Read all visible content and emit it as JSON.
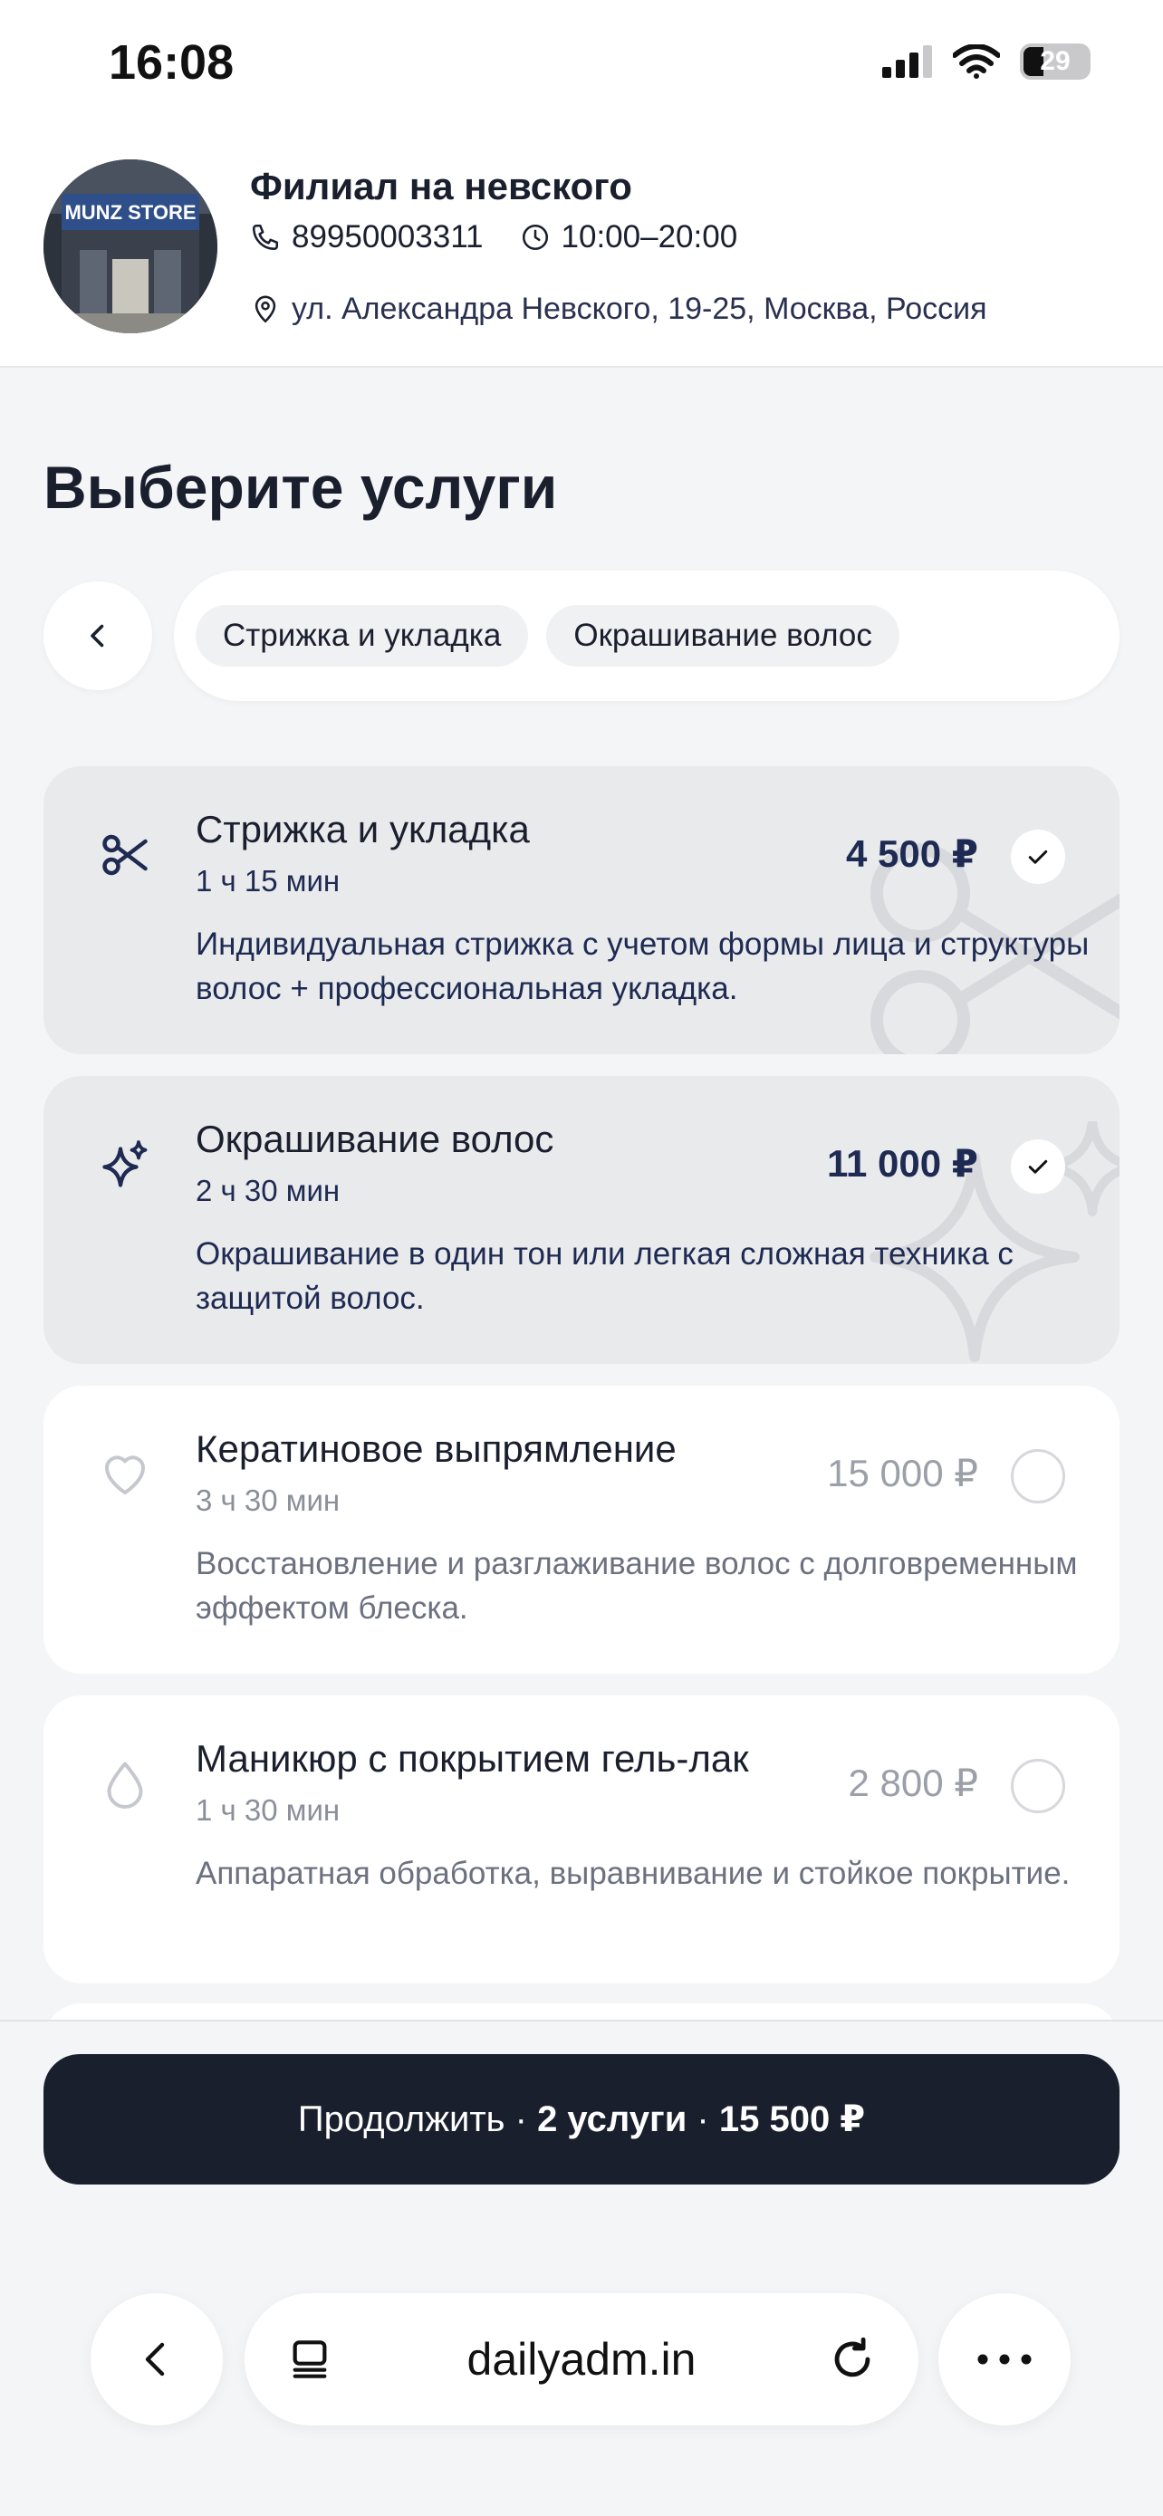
{
  "status_bar": {
    "time": "16:08",
    "battery": "29"
  },
  "branch": {
    "name": "Филиал на невского",
    "phone": "89950003311",
    "hours": "10:00–20:00",
    "address": "ул. Александра Невского, 19-25, Москва, Россия",
    "store_sign": "MUNZ STORE"
  },
  "page_title": "Выберите услуги",
  "category_chips": [
    "Стрижка и укладка",
    "Окрашивание волос"
  ],
  "services": [
    {
      "title": "Стрижка и укладка",
      "duration": "1 ч 15 мин",
      "price": "4 500 ₽",
      "description": "Индивидуальная стрижка с учетом формы лица и структуры волос + профессиональная укладка.",
      "selected": true,
      "icon": "scissors-icon"
    },
    {
      "title": "Окрашивание волос",
      "duration": "2 ч 30 мин",
      "price": "11 000 ₽",
      "description": "Окрашивание в один тон или легкая сложная техника с защитой волос.",
      "selected": true,
      "icon": "sparkles-icon"
    },
    {
      "title": "Кератиновое выпрямление",
      "duration": "3 ч 30 мин",
      "price": "15 000 ₽",
      "description": "Восстановление и разглаживание волос с долговременным эффектом блеска.",
      "selected": false,
      "icon": "heart-icon"
    },
    {
      "title": "Маникюр с покрытием гель-лак",
      "duration": "1 ч 30 мин",
      "price": "2 800 ₽",
      "description": "Аппаратная обработка, выравнивание и стойкое покрытие.",
      "selected": false,
      "icon": "drop-icon"
    }
  ],
  "cta": {
    "prefix": "Продолжить · ",
    "count": "2 услуги",
    "sep": " · ",
    "total": "15 500 ₽"
  },
  "browser": {
    "url": "dailyadm.in"
  },
  "colors": {
    "accent": "#1a1f2e",
    "selected_card": "#e9eaec",
    "background": "#f4f5f7"
  }
}
